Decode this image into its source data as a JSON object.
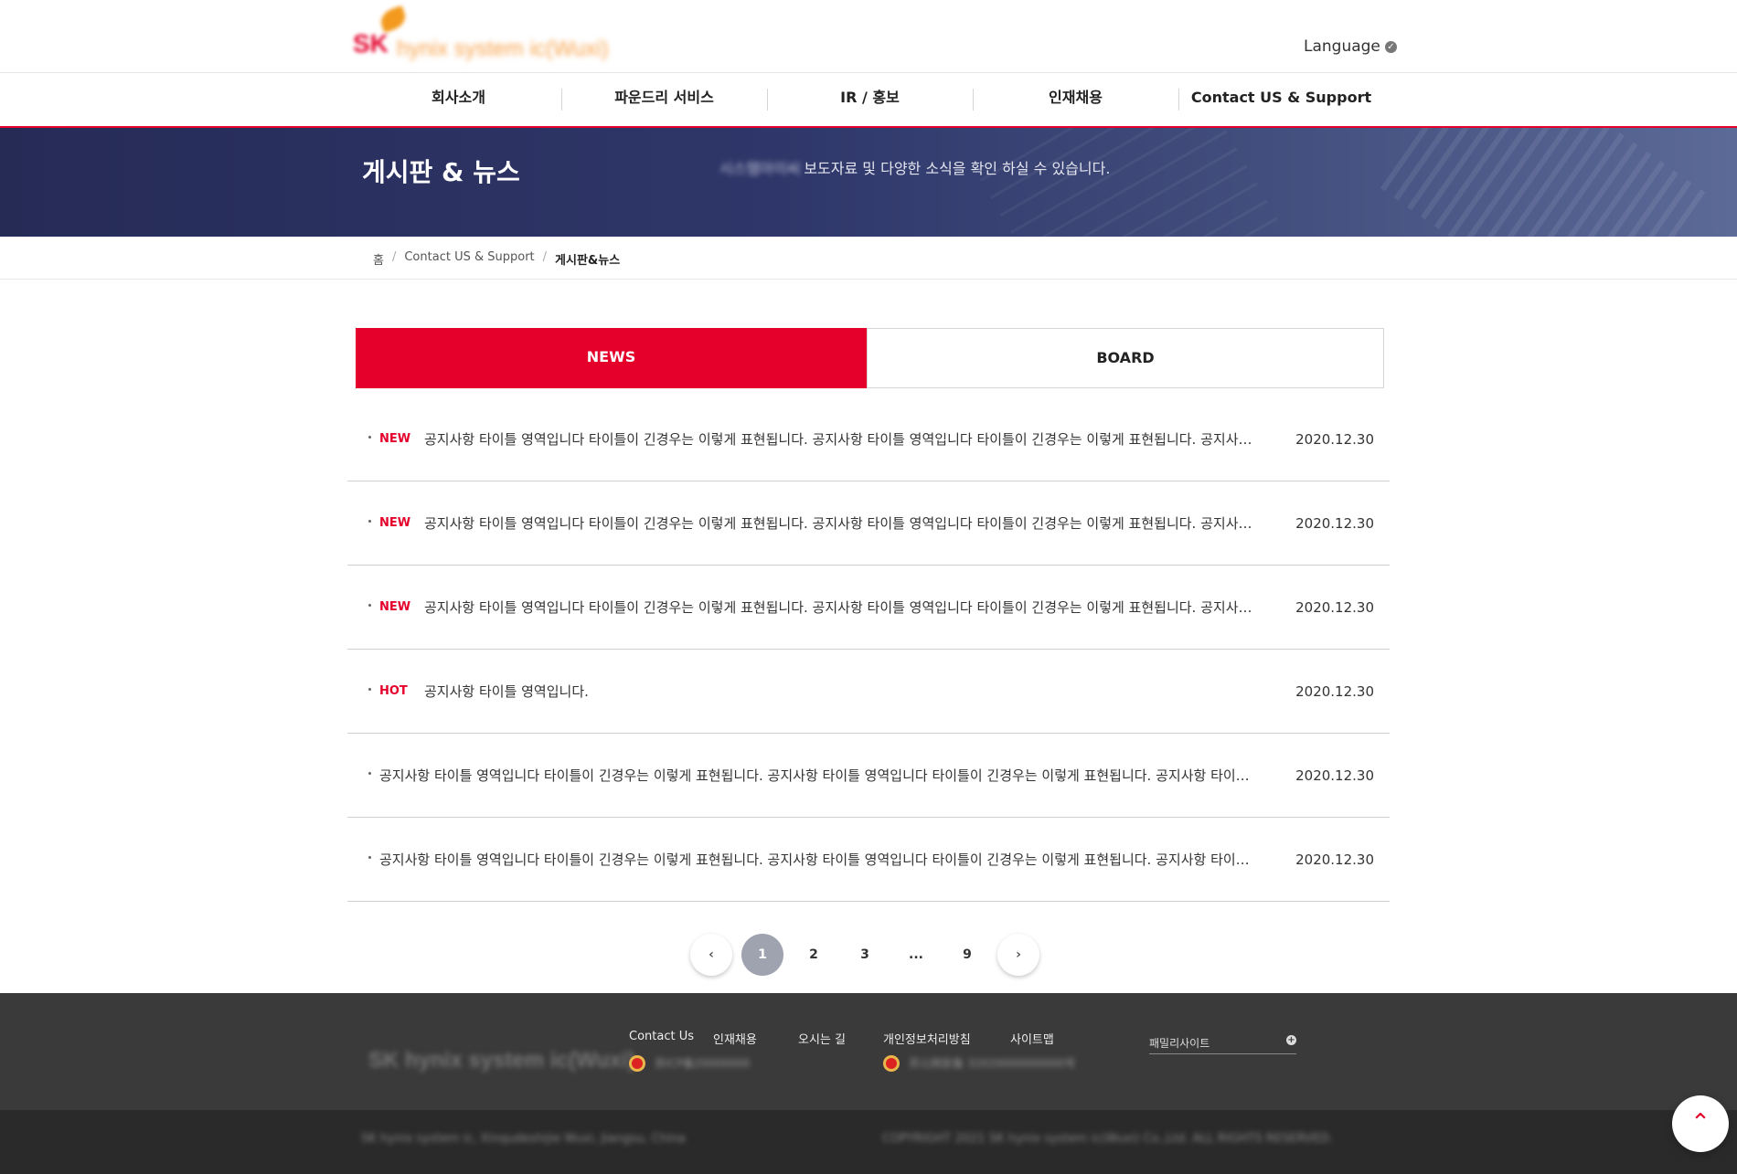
{
  "header": {
    "logo_text": "SK hynix system ic(Wuxi)",
    "language_label": "Language",
    "language_icon": "check-circle-icon"
  },
  "gnb": {
    "items": [
      {
        "label": "회사소개"
      },
      {
        "label": "파운드리 서비스"
      },
      {
        "label": "IR / 홍보"
      },
      {
        "label": "인재채용"
      },
      {
        "label": "Contact US & Support"
      }
    ]
  },
  "visual": {
    "title": "게시판 & 뉴스",
    "desc_blurred": "시스템아이씨",
    "desc": "보도자료 및 다양한 소식을 확인 하실 수 있습니다."
  },
  "breadcrumb": {
    "home": "홈",
    "parent": "Contact US & Support",
    "current": "게시판&뉴스",
    "separator": "/"
  },
  "tabs": {
    "news": "NEWS",
    "board": "BOARD"
  },
  "news": [
    {
      "badge": "NEW",
      "title": "공지사항 타이틀 영역입니다 타이틀이 긴경우는 이렇게 표현됩니다. 공지사항 타이틀 영역입니다 타이틀이 긴경우는 이렇게 표현됩니다. 공지사항 타이틀 영역입니다",
      "date": "2020.12.30"
    },
    {
      "badge": "NEW",
      "title": "공지사항 타이틀 영역입니다 타이틀이 긴경우는 이렇게 표현됩니다. 공지사항 타이틀 영역입니다 타이틀이 긴경우는 이렇게 표현됩니다. 공지사항 타이틀 영역입니다",
      "date": "2020.12.30"
    },
    {
      "badge": "NEW",
      "title": "공지사항 타이틀 영역입니다 타이틀이 긴경우는 이렇게 표현됩니다. 공지사항 타이틀 영역입니다 타이틀이 긴경우는 이렇게 표현됩니다. 공지사항 타이틀 영역입니다",
      "date": "2020.12.30"
    },
    {
      "badge": "HOT",
      "title": "공지사항 타이틀 영역입니다.",
      "date": "2020.12.30"
    },
    {
      "badge": "",
      "title": "공지사항 타이틀 영역입니다 타이틀이 긴경우는 이렇게 표현됩니다. 공지사항 타이틀 영역입니다 타이틀이 긴경우는 이렇게 표현됩니다. 공지사항 타이틀 영역입니다",
      "date": "2020.12.30"
    },
    {
      "badge": "",
      "title": "공지사항 타이틀 영역입니다 타이틀이 긴경우는 이렇게 표현됩니다. 공지사항 타이틀 영역입니다 타이틀이 긴경우는 이렇게 표현됩니다. 공지사항 타이틀 영역입니다",
      "date": "2020.12.30"
    }
  ],
  "pagination": {
    "prev": "‹",
    "pages": [
      "1",
      "2",
      "3",
      "...",
      "9"
    ],
    "current": "1",
    "next": "›"
  },
  "footer": {
    "logo_text": "SK hynix system ic(Wuxi)",
    "links": [
      "Contact Us",
      "인재채용",
      "오시는 길",
      "개인정보처리방침",
      "사이트맵"
    ],
    "registration_1": "苏ICP备20000000",
    "registration_2": "苏公网安备 32020000000000号",
    "family_site": "패밀리사이트",
    "family_icon": "plus-circle-icon",
    "address": "SK hynix system ic, Xinqudeshijie Wuxi, Jiangsu, China",
    "copyright": "COPYRIGHT 2021 SK hynix system ic(Wuxi) Co.,Ltd. ALL RIGHTS RESERVED."
  },
  "top_button": {
    "icon": "chevron-up-icon",
    "label": "⌃"
  },
  "colors": {
    "accent": "#e4002b",
    "visual_bg": "#2f376a",
    "footer_bg": "#3a3a3a",
    "footer_bottom_bg": "#2a2a2a",
    "page_active": "#9fa3af"
  }
}
